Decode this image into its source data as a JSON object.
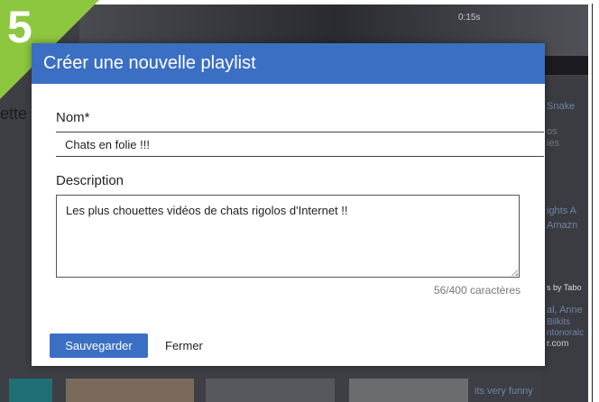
{
  "step_badge": {
    "number": "5"
  },
  "background": {
    "video_time": "0:15s",
    "heading_fragment": "ette",
    "right_texts": [
      "Snake",
      "os",
      "ies",
      "ights A",
      "Amazn",
      "s by Tabo",
      "al, Anne",
      "Bilkits",
      "ntonoralc",
      "r.com",
      "its very funny"
    ]
  },
  "modal": {
    "title": "Créer une nouvelle playlist",
    "name_label": "Nom*",
    "name_value": "Chats en folie !!!",
    "description_label": "Description",
    "description_value": "Les plus chouettes vidéos de chats rigolos d'Internet !!",
    "char_counter": "56/400 caractères",
    "save_label": "Sauvegarder",
    "close_label": "Fermer"
  },
  "colors": {
    "header": "#3b6fc4",
    "badge": "#8dc63f",
    "backdrop": "#3d3f44"
  }
}
